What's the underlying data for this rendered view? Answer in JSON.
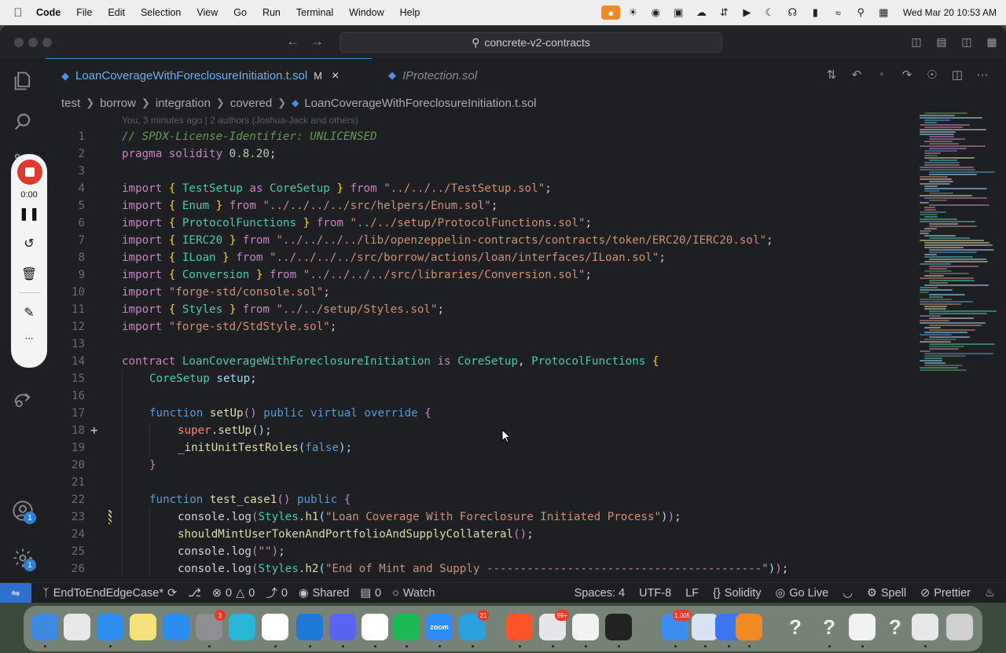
{
  "menubar": {
    "app": "Code",
    "items": [
      "File",
      "Edit",
      "Selection",
      "View",
      "Go",
      "Run",
      "Terminal",
      "Window",
      "Help"
    ],
    "clock": "Wed Mar 20  10:53 AM"
  },
  "titlebar": {
    "search": "concrete-v2-contracts"
  },
  "tabs": [
    {
      "label": "LoanCoverageWithForeclosureInitiation.t.sol",
      "modified": "M",
      "close": "×"
    },
    {
      "label": "IProtection.sol"
    }
  ],
  "breadcrumb": [
    "test",
    "borrow",
    "integration",
    "covered",
    "LoanCoverageWithForeclosureInitiation.t.sol"
  ],
  "blame": "You, 3 minutes ago | 2 authors (Joshua-Jack and others)",
  "recorder": {
    "time": "0:00"
  },
  "activity": {
    "accounts_badge": "1",
    "settings_badge": "1"
  },
  "line_numbers": [
    "1",
    "2",
    "3",
    "4",
    "5",
    "6",
    "7",
    "8",
    "9",
    "10",
    "11",
    "12",
    "13",
    "14",
    "15",
    "16",
    "17",
    "18",
    "19",
    "20",
    "21",
    "22",
    "23",
    "24",
    "25",
    "26"
  ],
  "code": {
    "l1": "// SPDX-License-Identifier: UNLICENSED",
    "l2_kw": "pragma solidity",
    "l2_ver": "0.8.20",
    "l4_a": "TestSetup",
    "l4_b": "CoreSetup",
    "l4_path": "\"../../../TestSetup.sol\"",
    "l5_a": "Enum",
    "l5_path": "\"../../../../src/helpers/Enum.sol\"",
    "l6_a": "ProtocolFunctions",
    "l6_path": "\"../../setup/ProtocolFunctions.sol\"",
    "l7_a": "IERC20",
    "l7_path": "\"../../../../lib/openzeppelin-contracts/contracts/token/ERC20/IERC20.sol\"",
    "l8_a": "ILoan",
    "l8_path": "\"../../../../src/borrow/actions/loan/interfaces/ILoan.sol\"",
    "l9_a": "Conversion",
    "l9_path": "\"../../../../src/libraries/Conversion.sol\"",
    "l10_path": "\"forge-std/console.sol\"",
    "l11_a": "Styles",
    "l11_path": "\"../../setup/Styles.sol\"",
    "l12_path": "\"forge-std/StdStyle.sol\"",
    "l14_name": "LoanCoverageWithForeclosureInitiation",
    "l14_p1": "CoreSetup",
    "l14_p2": "ProtocolFunctions",
    "l15_type": "CoreSetup",
    "l15_var": "setup",
    "l17_fn": "setUp",
    "l18_obj": "super",
    "l18_fn": "setUp",
    "l19_fn": "_initUnitTestRoles",
    "l19_arg": "false",
    "l22_fn": "test_case1",
    "l23_str": "\"Loan Coverage With Foreclosure Initiated Process\"",
    "l24_fn": "shouldMintUserTokenAndPortfolioAndSupplyCollateral",
    "l25_str": "\"\"",
    "l26_str": "\"End of Mint and Supply -----------------------------------------\""
  },
  "status": {
    "branch": "EndToEndEdgeCase*",
    "errors": "0",
    "warnings": "0",
    "ports": "0",
    "shared": "Shared",
    "shared_count": "0",
    "watch": "Watch",
    "spaces": "Spaces: 4",
    "encoding": "UTF-8",
    "eol": "LF",
    "language": "Solidity",
    "golive": "Go Live",
    "spell": "Spell",
    "prettier": "Prettier"
  },
  "dock": {
    "badges": {
      "settings": "3",
      "telegram": "21",
      "craft": "99+",
      "mail": "1,005"
    },
    "labels": {
      "zoom": "zoom"
    }
  }
}
